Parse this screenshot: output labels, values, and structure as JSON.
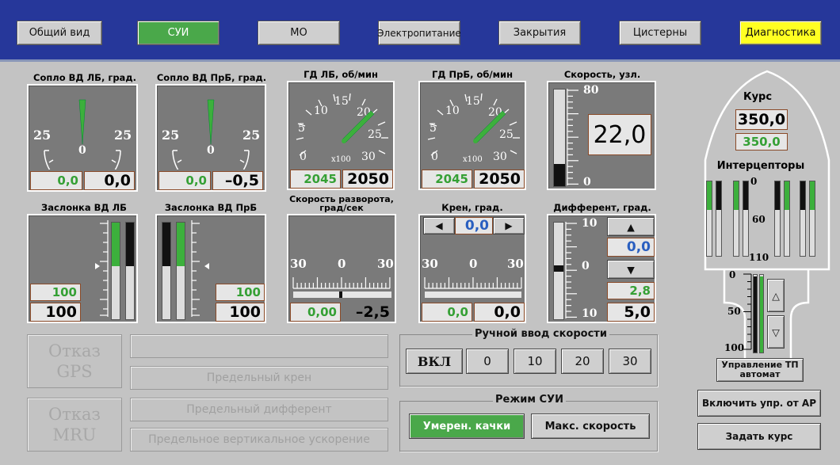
{
  "nav": {
    "tabs": [
      {
        "label": "Общий вид"
      },
      {
        "label": "СУИ"
      },
      {
        "label": "МО"
      },
      {
        "label": "Электропитание"
      },
      {
        "label": "Закрытия"
      },
      {
        "label": "Цистерны"
      },
      {
        "label": "Диагностика"
      }
    ],
    "active_tab": "СУИ"
  },
  "gauges": {
    "nozzle_left": {
      "title": "Сопло ВД ЛБ, град.",
      "scale_min": "25",
      "scale_zero": "0",
      "scale_max": "25",
      "set_value": "0,0",
      "actual_value": "0,0"
    },
    "nozzle_right": {
      "title": "Сопло ВД ПрБ, град.",
      "scale_min": "25",
      "scale_zero": "0",
      "scale_max": "25",
      "set_value": "0,0",
      "actual_value": "–0,5"
    },
    "engine_left": {
      "title": "ГД ЛБ, об/мин",
      "ticks": [
        "0",
        "5",
        "10",
        "15",
        "20",
        "25",
        "30"
      ],
      "multiplier": "x100",
      "set_value": "2045",
      "actual_value": "2050"
    },
    "engine_right": {
      "title": "ГД ПрБ, об/мин",
      "ticks": [
        "0",
        "5",
        "10",
        "15",
        "20",
        "25",
        "30"
      ],
      "multiplier": "x100",
      "set_value": "2045",
      "actual_value": "2050"
    },
    "speed": {
      "title": "Скорость, узл.",
      "max": "80",
      "min": "0",
      "value": "22,0",
      "fill_fraction": 0.23
    },
    "flap_left": {
      "title": "Заслонка ВД ЛБ",
      "set_value": "100",
      "actual_value": "100"
    },
    "flap_right": {
      "title": "Заслонка ВД ПрБ",
      "set_value": "100",
      "actual_value": "100"
    },
    "turn_rate": {
      "title": "Скорость разворота, град/сек",
      "scale_left": "30",
      "scale_zero": "0",
      "scale_right": "30",
      "set_value": "0,00",
      "actual_value": "–2,5"
    },
    "roll": {
      "title": "Крен, град.",
      "top_value": "0,0",
      "scale_left": "30",
      "scale_zero": "0",
      "scale_right": "30",
      "set_value": "0,0",
      "actual_value": "0,0"
    },
    "trim": {
      "title": "Дифферент, град.",
      "scale_top": "10",
      "scale_zero": "0",
      "scale_bottom": "10",
      "target_value": "0,0",
      "set_value": "2,8",
      "actual_value": "5,0"
    }
  },
  "course": {
    "title": "Курс",
    "value": "350,0",
    "set_value": "350,0"
  },
  "interceptors": {
    "title": "Интерцепторы",
    "scale": [
      "0",
      "60",
      "110"
    ]
  },
  "tp_control": {
    "scale": [
      "0",
      "50",
      "100"
    ],
    "label": "Управление ТП автомат"
  },
  "failures": {
    "gps": "Отказ GPS",
    "mru": "Отказ MRU"
  },
  "warnings": {
    "blank": "",
    "roll_limit": "Предельный крен",
    "trim_limit": "Предельный дифферент",
    "vert_accel_limit": "Предельное вертикальное ускорение"
  },
  "manual_speed": {
    "title": "Ручной ввод скорости",
    "buttons": [
      "ВКЛ",
      "0",
      "10",
      "20",
      "30"
    ]
  },
  "sui_mode": {
    "title": "Режим СУИ",
    "buttons": [
      "Умерен. качки",
      "Макс. скорость"
    ]
  },
  "actions": {
    "enable_ap": "Включить упр. от АР",
    "set_course": "Задать курс"
  },
  "colors": {
    "header_blue": "#26379a",
    "active_green": "#4aa84a",
    "diagnostic_yellow": "#ffff22",
    "needle_green": "#3cb03c"
  }
}
